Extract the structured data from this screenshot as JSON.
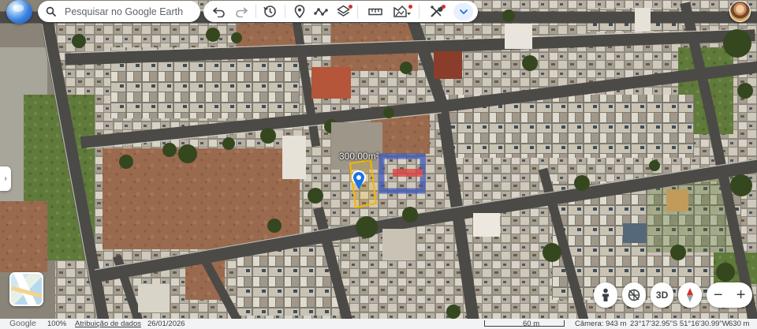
{
  "search": {
    "placeholder": "Pesquisar no Google Earth"
  },
  "toolbar": {
    "buttons": [
      {
        "name": "undo-button",
        "icon": "undo-icon"
      },
      {
        "name": "redo-button",
        "icon": "redo-icon"
      },
      {
        "name": "history-button",
        "icon": "history-icon"
      },
      {
        "name": "add-placemark-button",
        "icon": "placemark-icon"
      },
      {
        "name": "add-path-button",
        "icon": "path-icon"
      },
      {
        "name": "layers-button",
        "icon": "layers-icon"
      },
      {
        "name": "measure-button",
        "icon": "ruler-icon"
      },
      {
        "name": "map-style-button",
        "icon": "terrain-icon"
      },
      {
        "name": "tools-button",
        "icon": "tools-icon"
      },
      {
        "name": "collapse-toolbar-button",
        "icon": "chevron-down-icon"
      }
    ],
    "accent": "#1a73e8",
    "notification_color": "#d93025"
  },
  "map": {
    "parcel_area": "300,00m²",
    "parcel_color": "#f5b500",
    "marker_color": "#1a73e8"
  },
  "controls": {
    "pegman": "pegman-icon",
    "compass_reset": "reset-tilt-icon",
    "view_3d": "3D",
    "compass": "compass-icon",
    "zoom_out": "−",
    "zoom_in": "+"
  },
  "statusbar": {
    "brand": "Google",
    "zoom": "100%",
    "attribution": "Atribuição de dados",
    "date": "26/01/2026",
    "scale": "60 m",
    "camera": "Câmera: 943 m",
    "coordinates": "23°17'32.95\"S 51°16'30.99\"W",
    "elevation": "630 m"
  }
}
